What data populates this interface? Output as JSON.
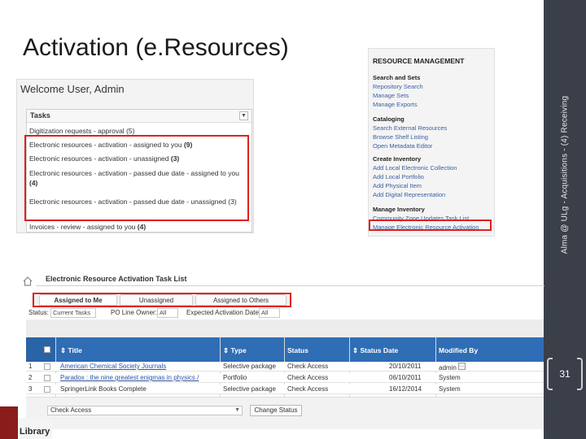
{
  "slide": {
    "title": "Activation (e.Resources)",
    "side_caption": "Alma @ ULg - Acquisitions - (4) Receiving",
    "page_number": "31"
  },
  "welcome": {
    "title": "Welcome User, Admin",
    "tasks_header": "Tasks",
    "tasks": [
      {
        "text": "Digitization requests - approval",
        "count": "(5)"
      },
      {
        "text": "Electronic resources - activation - assigned to you",
        "count": "(9)"
      },
      {
        "text": "Electronic resources - activation - unassigned",
        "count": "(3)"
      },
      {
        "text": "Electronic resources - activation - passed due date - assigned to you",
        "count": "(4)"
      },
      {
        "text": "Electronic resources - activation - passed due date - unassigned",
        "count": "(3)"
      },
      {
        "text": "Invoices - review - assigned to you",
        "count": "(4)"
      }
    ]
  },
  "resource_management": {
    "title": "RESOURCE MANAGEMENT",
    "sections": [
      {
        "heading": "Search and Sets",
        "items": [
          "Repository Search",
          "Manage Sets",
          "Manage Exports"
        ]
      },
      {
        "heading": "Cataloging",
        "items": [
          "Search External Resources",
          "Browse Shelf Listing",
          "Open Metadata Editor"
        ]
      },
      {
        "heading": "Create Inventory",
        "items": [
          "Add Local Electronic Collection",
          "Add Local Portfolio",
          "Add Physical Item",
          "Add Digital Representation"
        ]
      },
      {
        "heading": "Manage Inventory",
        "items": [
          "Community Zone Updates Task List",
          "Manage Electronic Resource Activation"
        ]
      }
    ]
  },
  "task_list": {
    "title": "Electronic Resource Activation Task List",
    "tabs": [
      "Assigned to Me",
      "Unassigned",
      "Assigned to Others"
    ],
    "filters": {
      "status_label": "Status:",
      "status_value": "Current Tasks",
      "po_label": "PO Line Owner:",
      "po_value": "All",
      "exp_label": "Expected Activation Date:",
      "exp_value": "All"
    },
    "columns": [
      "Title",
      "Type",
      "Status",
      "Status Date",
      "Modified By"
    ],
    "rows": [
      {
        "num": "1",
        "title": "American Chemical Society Journals",
        "type": "Selective package",
        "status": "Check Access",
        "date": "20/10/2011",
        "modified": "admin"
      },
      {
        "num": "2",
        "title": "Paradox : the nine greatest enigmas in physics /",
        "type": "Portfolio",
        "status": "Check Access",
        "date": "06/10/2011",
        "modified": "System"
      },
      {
        "num": "3",
        "title": "SpringerLink Books Complete",
        "type": "Selective package",
        "status": "Check Access",
        "date": "16/12/2014",
        "modified": "System"
      }
    ],
    "bulk_action_value": "Check Access",
    "change_status_label": "Change Status"
  },
  "logo": {
    "text": "Library"
  },
  "colors": {
    "accent": "#2f6db5",
    "highlight": "#e02020",
    "side_band": "#3a3f4a"
  }
}
